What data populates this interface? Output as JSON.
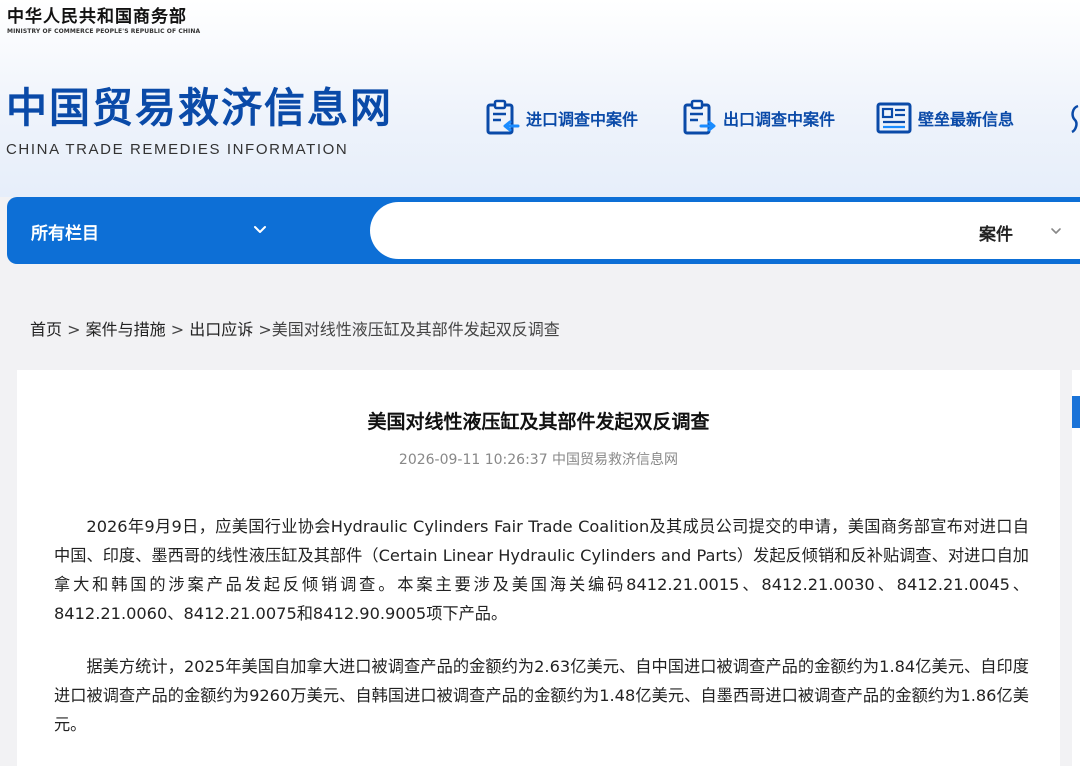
{
  "header": {
    "ministry_cn": "中华人民共和国商务部",
    "ministry_en": "MINISTRY OF COMMERCE PEOPLE'S REPUBLIC OF CHINA",
    "site_title_cn": "中国贸易救济信息网",
    "site_title_en": "CHINA TRADE REMEDIES INFORMATION",
    "quick_links": [
      {
        "label": "进口调查中案件",
        "icon": "import-cases-icon"
      },
      {
        "label": "出口调查中案件",
        "icon": "export-cases-icon"
      },
      {
        "label": "壁垒最新信息",
        "icon": "barrier-news-icon"
      }
    ]
  },
  "search": {
    "category": "所有栏目",
    "query": "",
    "type": "案件"
  },
  "breadcrumb": {
    "home": "首页",
    "level1": "案件与措施",
    "level2": "出口应诉",
    "current": "美国对线性液压缸及其部件发起双反调查",
    "separator": ">"
  },
  "article": {
    "title": "美国对线性液压缸及其部件发起双反调查",
    "meta": "2026-09-11 10:26:37 中国贸易救济信息网",
    "paragraphs": [
      "2026年9月9日，应美国行业协会Hydraulic Cylinders Fair Trade Coalition及其成员公司提交的申请，美国商务部宣布对进口自中国、印度、墨西哥的线性液压缸及其部件（Certain Linear Hydraulic Cylinders and Parts）发起反倾销和反补贴调查、对进口自加拿大和韩国的涉案产品发起反倾销调查。本案主要涉及美国海关编码8412.21.0015、8412.21.0030、8412.21.0045、8412.21.0060、8412.21.0075和8412.90.9005项下产品。",
      "据美方统计，2025年美国自加拿大进口被调查产品的金额约为2.63亿美元、自中国进口被调查产品的金额约为1.84亿美元、自印度进口被调查产品的金额约为9260万美元、自韩国进口被调查产品的金额约为1.48亿美元、自墨西哥进口被调查产品的金额约为1.86亿美元。"
    ]
  },
  "colors": {
    "brand_blue": "#0a4aa8",
    "search_bar_blue": "#0d6fd6",
    "page_background": "#f2f2f4"
  }
}
